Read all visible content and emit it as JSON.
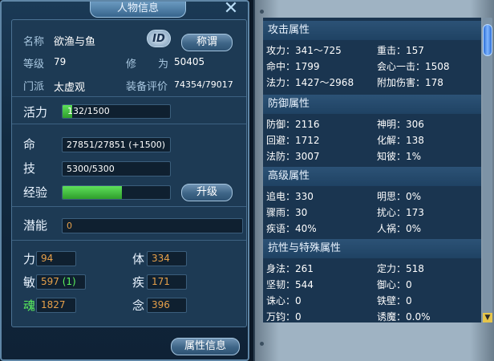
{
  "character": {
    "title": "人物信息",
    "name_label": "名称",
    "name_value": "欲渔与鱼",
    "id_badge": "ID",
    "title_button": "称谓",
    "level_label": "等级",
    "level_value": "79",
    "cultivation_label_1": "修",
    "cultivation_label_2": "为",
    "cultivation_value": "50405",
    "sect_label": "门派",
    "sect_value": "太虚观",
    "gear_score_label": "装备评价",
    "gear_score_value": "74354/79017",
    "vitality_label": "活力",
    "vitality_value": "132/1500",
    "vitality_fraction": 0.088,
    "hp_label": "命",
    "hp_value": "27851/27851 (+1500)",
    "skill_label": "技",
    "skill_value": "5300/5300",
    "exp_label": "经验",
    "exp_fraction": 0.55,
    "upgrade_button": "升级",
    "potential_label": "潜能",
    "potential_value": "0",
    "str_label": "力",
    "str_value": "94",
    "con_label": "体",
    "con_value": "334",
    "agi_label": "敏",
    "agi_value": "597 (1)",
    "spd_label": "疾",
    "spd_value": "171",
    "soul_label": "魂",
    "soul_value": "1827",
    "mind_label": "念",
    "mind_value": "396",
    "attr_button": "属性信息"
  },
  "attributes": {
    "attack": {
      "header": "攻击属性",
      "rows": [
        [
          "攻力：341～725",
          "重击：157"
        ],
        [
          "命中：1799",
          "会心一击：1508"
        ],
        [
          "法力：1427～2968",
          "附加伤害：178"
        ]
      ]
    },
    "defense": {
      "header": "防御属性",
      "rows": [
        [
          "防御：2116",
          "神明：306"
        ],
        [
          "回避：1712",
          "化解：138"
        ],
        [
          "法防：3007",
          "知彼：1%"
        ]
      ]
    },
    "advanced": {
      "header": "高级属性",
      "rows": [
        [
          "追电：330",
          "明思：0%"
        ],
        [
          "骤雨：30",
          "扰心：173"
        ],
        [
          "疾语：40%",
          "人祸：0%"
        ]
      ]
    },
    "resist": {
      "header": "抗性与特殊属性",
      "rows": [
        [
          "身法：261",
          "定力：518"
        ],
        [
          "坚韧：544",
          "御心：0"
        ],
        [
          "诛心：0",
          "铁壁：0"
        ],
        [
          "万钧：0",
          "诱魔：0.0%"
        ]
      ]
    }
  },
  "colors": {
    "panel_blue": "#1d3a54",
    "accent_green": "#5cf25c",
    "value_orange": "#e6a04a",
    "scroll_blue": "#2d6ed6"
  }
}
